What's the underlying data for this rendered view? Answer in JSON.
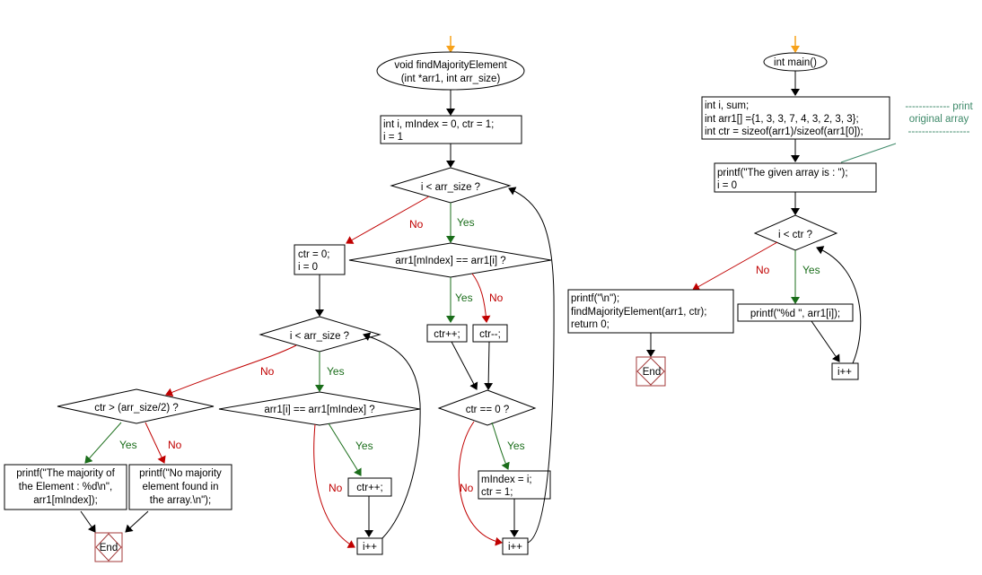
{
  "diagram": {
    "findMajority": {
      "start": [
        "void findMajorityElement",
        "(int *arr1, int arr_size)"
      ],
      "init": [
        "int i, mIndex = 0, ctr = 1;",
        "i = 1"
      ],
      "loop1_cond": "i < arr_size ?",
      "cmp1": "arr1[mIndex] == arr1[i] ?",
      "inc": "ctr++;",
      "dec": "ctr--;",
      "zero_cond": "ctr == 0 ?",
      "reset": [
        "mIndex = i;",
        "ctr = 1;"
      ],
      "iinc1": "i++",
      "init2": [
        "ctr = 0;",
        "i = 0"
      ],
      "loop2_cond": "i < arr_size ?",
      "cmp2": "arr1[i] == arr1[mIndex] ?",
      "inc2": "ctr++;",
      "iinc2": "i++",
      "major_cond": "ctr > (arr_size/2) ?",
      "print_yes": [
        "printf(\"The majority of",
        "the Element : %d\\n\",",
        "arr1[mIndex]);"
      ],
      "print_no": [
        "printf(\"No majority",
        "element found in",
        "the array.\\n\");"
      ],
      "end": "End"
    },
    "main": {
      "start": "int main()",
      "decl": [
        "int i, sum;",
        "int arr1[] ={1, 3, 3, 7, 4, 3, 2, 3, 3};",
        "int ctr = sizeof(arr1)/sizeof(arr1[0]);"
      ],
      "print_given": [
        "printf(\"The given array is :  \");",
        "i = 0"
      ],
      "loop_cond": "i < ctr ?",
      "print_elem": "printf(\"%d  \", arr1[i]);",
      "iinc": "i++",
      "final": [
        "printf(\"\\n\");",
        "findMajorityElement(arr1, ctr);",
        "return 0;"
      ],
      "end": "End",
      "note": [
        "------------- print",
        "original array",
        "------------------"
      ]
    },
    "labels": {
      "yes": "Yes",
      "no": "No"
    }
  }
}
